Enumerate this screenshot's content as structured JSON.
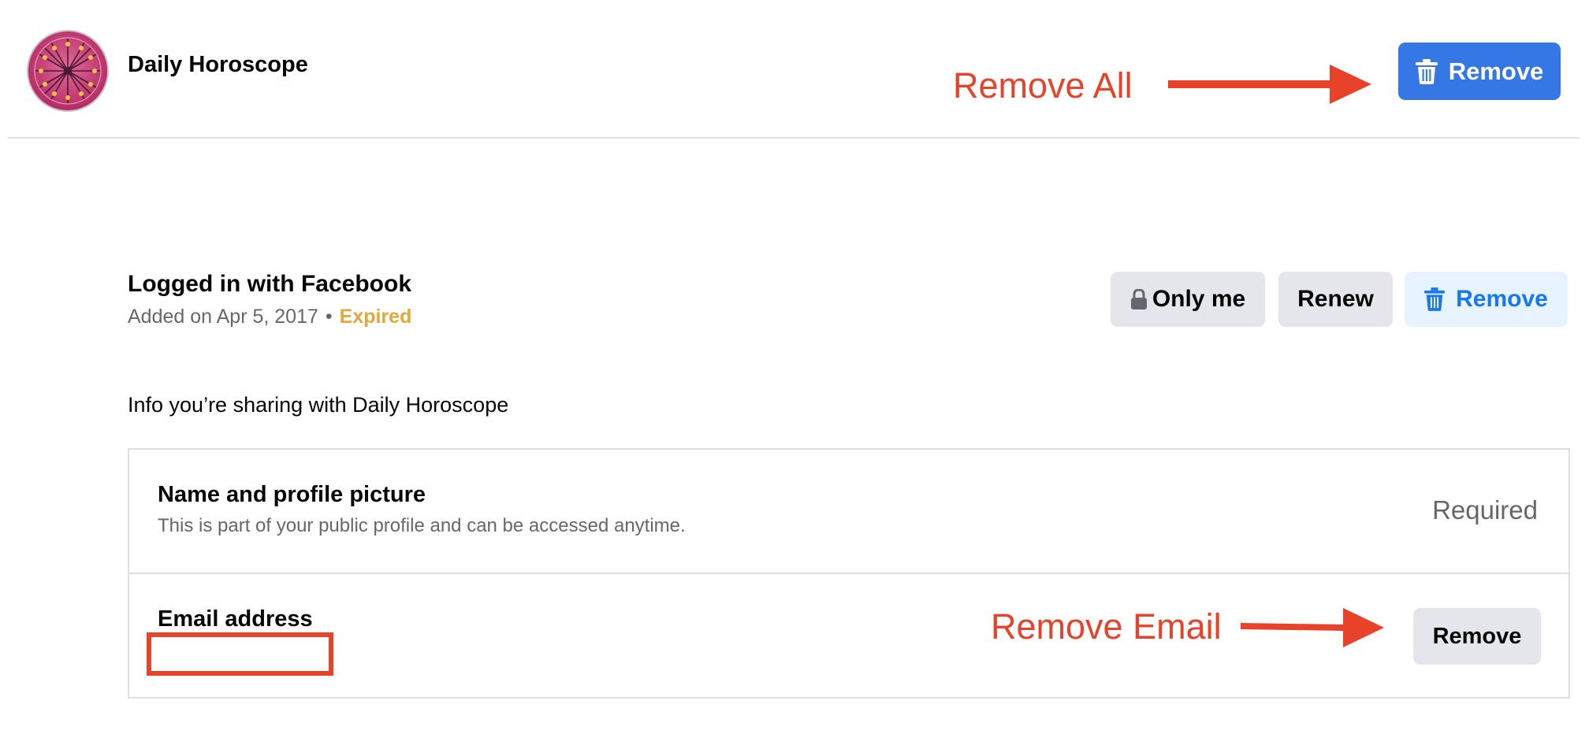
{
  "header": {
    "app_name": "Daily Horoscope",
    "remove_all_label": "Remove"
  },
  "annotations": {
    "remove_all": "Remove All",
    "remove_email": "Remove Email",
    "color": "#e8432a"
  },
  "login": {
    "title": "Logged in with Facebook",
    "added_on": "Added on Apr 5, 2017",
    "separator": "•",
    "status": "Expired",
    "audience_label": "Only me",
    "renew_label": "Renew",
    "remove_label": "Remove"
  },
  "sharing": {
    "heading": "Info you’re sharing with Daily Horoscope",
    "permissions": [
      {
        "title": "Name and profile picture",
        "description": "This is part of your public profile and can be accessed anytime.",
        "status": "Required"
      },
      {
        "title": "Email address",
        "action_label": "Remove"
      }
    ]
  },
  "colors": {
    "primary": "#3578e5",
    "expired": "#e3a73a",
    "button_gray": "#e4e6eb",
    "button_light": "#e7f3ff"
  },
  "icons": [
    "horoscope-app-icon",
    "trash-icon",
    "lock-icon",
    "arrow-right-icon"
  ]
}
